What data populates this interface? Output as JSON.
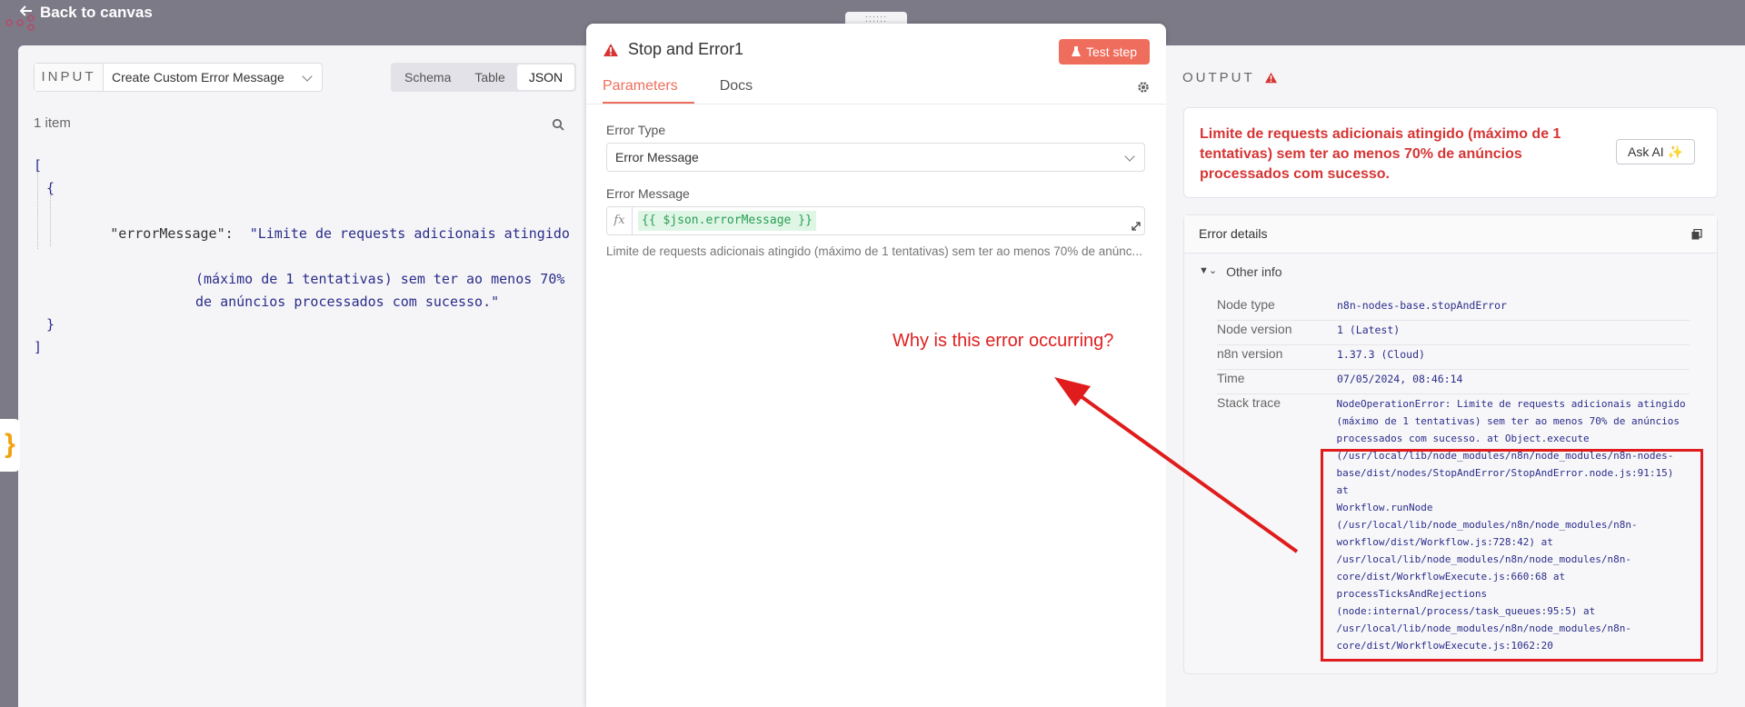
{
  "topbar": {
    "back_label": "Back to canvas"
  },
  "input_panel": {
    "label": "INPUT",
    "node_select": "Create Custom Error Message",
    "view_tabs": [
      "Schema",
      "Table",
      "JSON"
    ],
    "active_view": "JSON",
    "items_count": "1 item",
    "json": {
      "open_bracket": "[",
      "open_brace": "{",
      "key": "\"errorMessage\":",
      "value_lines": [
        "\"Limite de requests adicionais atingido",
        "(máximo de 1 tentativas) sem ter ao menos 70%",
        "de anúncios processados com sucesso.\""
      ],
      "close_brace": "}",
      "close_bracket": "]"
    }
  },
  "node_panel": {
    "title": "Stop and Error1",
    "test_button": "Test step",
    "tabs": [
      "Parameters",
      "Docs"
    ],
    "active_tab": "Parameters",
    "error_type_label": "Error Type",
    "error_type_value": "Error Message",
    "error_message_label": "Error Message",
    "fx": "fx",
    "expression": "{{ $json.errorMessage }}",
    "expression_preview": "Limite de requests adicionais atingido (máximo de 1 tentativas) sem ter ao menos 70% de anúnc..."
  },
  "annotation": {
    "text": "Why is this error occurring?",
    "color": "#e02020"
  },
  "output_panel": {
    "label": "OUTPUT",
    "error_message": "Limite de requests adicionais atingido (máximo de 1 tentativas) sem ter ao menos 70% de anúncios processados com sucesso.",
    "ask_ai": "Ask AI ✨",
    "details_title": "Error details",
    "other_info": "Other info",
    "rows": [
      {
        "key": "Node type",
        "value": "n8n-nodes-base.stopAndError"
      },
      {
        "key": "Node version",
        "value": "1 (Latest)"
      },
      {
        "key": "n8n version",
        "value": "1.37.3 (Cloud)"
      },
      {
        "key": "Time",
        "value": "07/05/2024, 08:46:14"
      }
    ],
    "stack_trace_label": "Stack trace",
    "stack_trace_lines": [
      "NodeOperationError: Limite de requests adicionais atingido",
      "(máximo de 1 tentativas) sem ter ao menos 70% de anúncios",
      "processados com sucesso. at Object.execute",
      "(/usr/local/lib/node_modules/n8n/node_modules/n8n-nodes-",
      "base/dist/nodes/StopAndError/StopAndError.node.js:91:15) at",
      "Workflow.runNode",
      "(/usr/local/lib/node_modules/n8n/node_modules/n8n-",
      "workflow/dist/Workflow.js:728:42) at",
      "/usr/local/lib/node_modules/n8n/node_modules/n8n-",
      "core/dist/WorkflowExecute.js:660:68 at",
      "processTicksAndRejections",
      "(node:internal/process/task_queues:95:5) at",
      "/usr/local/lib/node_modules/n8n/node_modules/n8n-",
      "core/dist/WorkflowExecute.js:1062:20"
    ]
  },
  "colors": {
    "accent": "#ef6d5c",
    "error": "#d63535",
    "code": "#2b2d8a"
  }
}
